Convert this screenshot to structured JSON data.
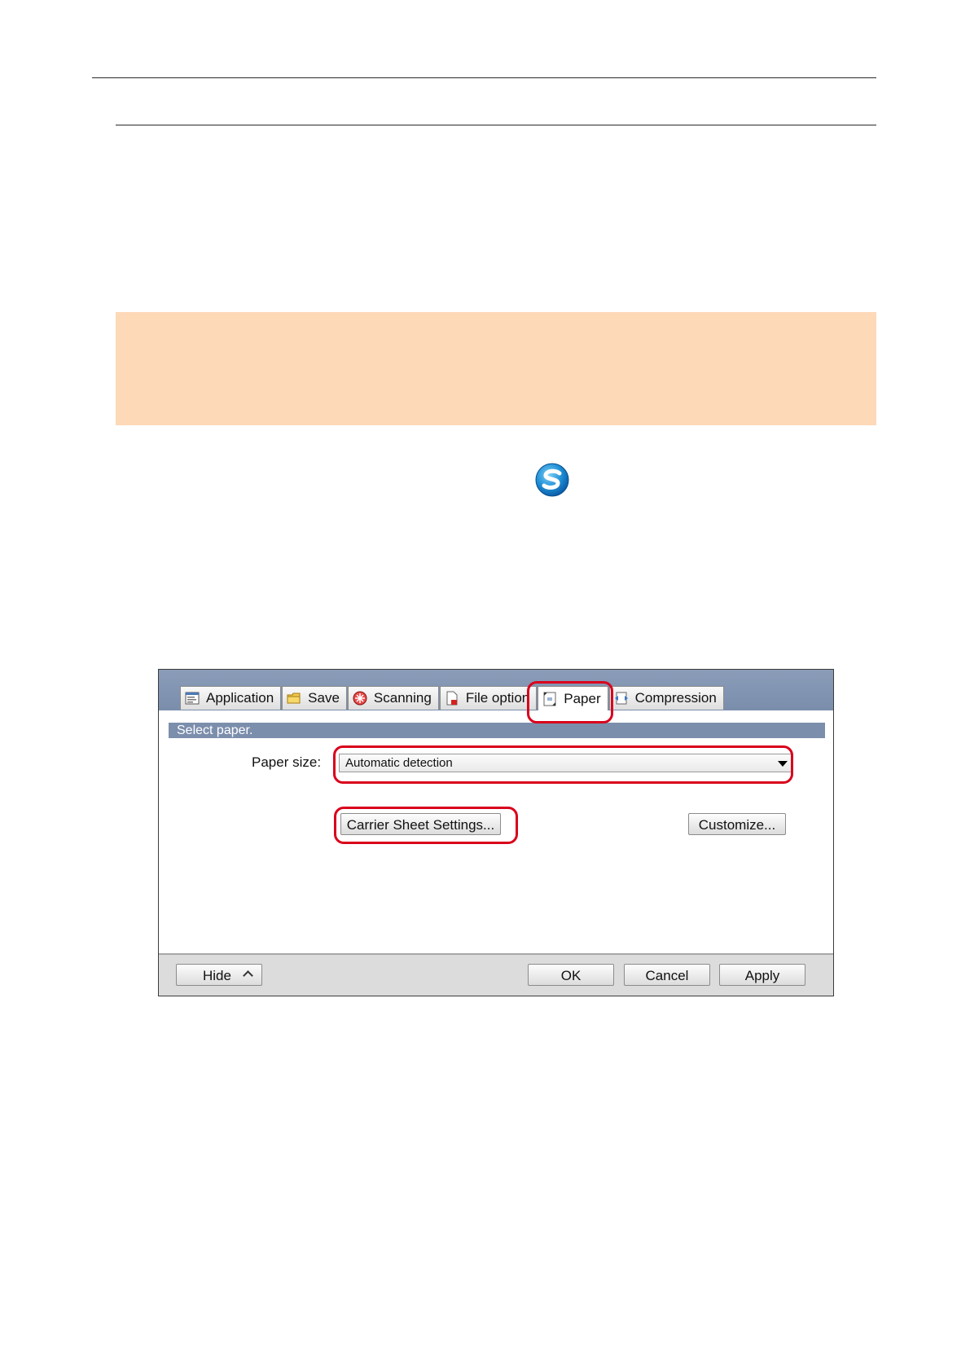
{
  "dialog": {
    "tabs": [
      {
        "label": "Application",
        "icon": "application-icon"
      },
      {
        "label": "Save",
        "icon": "folder-icon"
      },
      {
        "label": "Scanning",
        "icon": "scanning-icon"
      },
      {
        "label": "File option",
        "icon": "file-icon"
      },
      {
        "label": "Paper",
        "icon": "paper-icon",
        "active": true
      },
      {
        "label": "Compression",
        "icon": "compression-icon"
      }
    ],
    "section_title": "Select paper.",
    "paper_size_label": "Paper size:",
    "paper_size_value": "Automatic detection",
    "carrier_button": "Carrier Sheet Settings...",
    "customize_button": "Customize...",
    "footer": {
      "hide": "Hide",
      "ok": "OK",
      "cancel": "Cancel",
      "apply": "Apply"
    }
  },
  "colors": {
    "note_background": "#fdd9b8",
    "highlight": "#d9001b",
    "dialog_header": "#7b8eac"
  }
}
